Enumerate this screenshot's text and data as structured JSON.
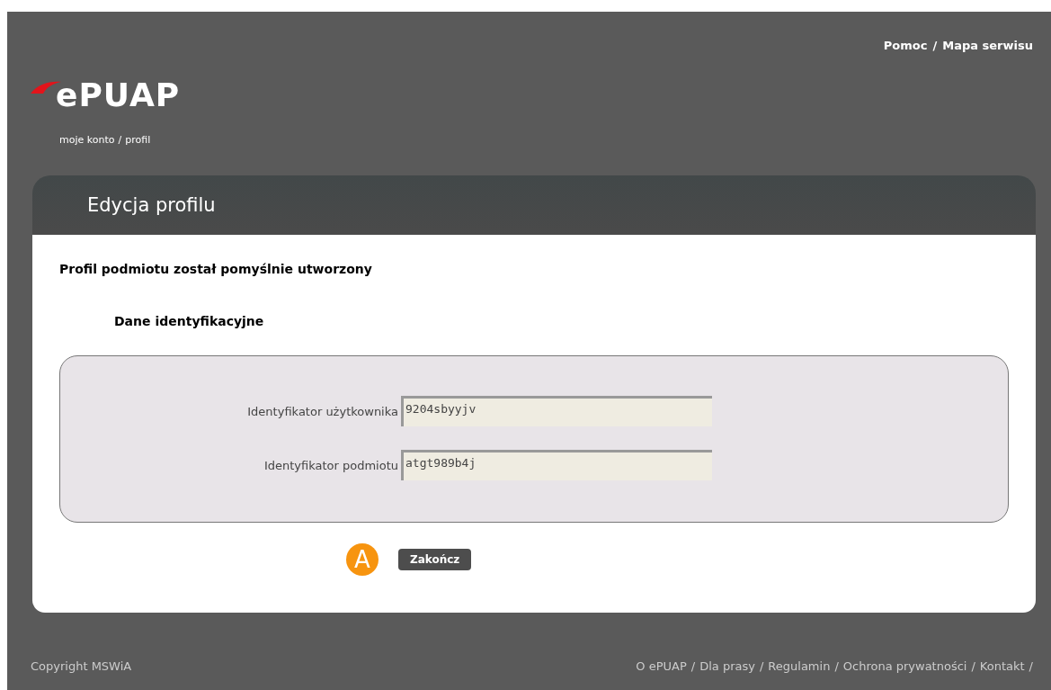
{
  "header": {
    "logo": "ePUAP",
    "links": [
      "Pomoc",
      "Mapa serwisu"
    ],
    "separator": "/"
  },
  "breadcrumb": {
    "items": [
      "moje konto",
      "profil"
    ],
    "separator": "/"
  },
  "panel": {
    "title": "Edycja profilu",
    "message": "Profil podmiotu został pomyślnie utworzony",
    "section_title": "Dane identyfikacyjne",
    "fields": [
      {
        "label": "Identyfikator użytkownika",
        "value": "9204sbyyjv"
      },
      {
        "label": "Identyfikator podmiotu",
        "value": "atgt989b4j"
      }
    ],
    "marker": "A",
    "button": "Zakończ"
  },
  "footer": {
    "copyright": "Copyright MSWiA",
    "links": [
      "O ePUAP",
      "Dla prasy",
      "Regulamin",
      "Ochrona prywatności",
      "Kontakt"
    ],
    "separator": "/"
  }
}
